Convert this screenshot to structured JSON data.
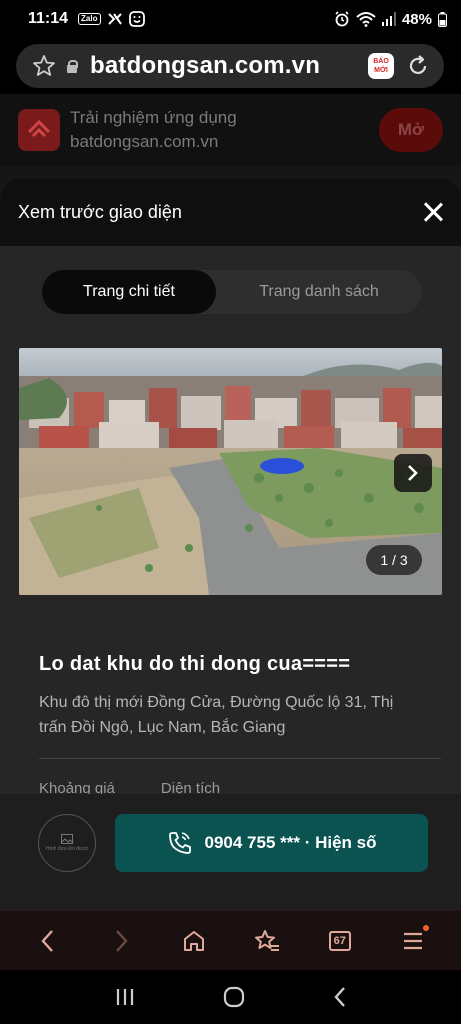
{
  "status_bar": {
    "time": "11:14",
    "notif_icons": [
      "zalo-icon",
      "alarm-off-icon",
      "face-icon"
    ],
    "zalo_label": "Zalo",
    "battery": "48%"
  },
  "browser": {
    "url": "batdongsan.com.vn",
    "baomoi_label": "BÁO MỚI"
  },
  "app_banner": {
    "line1": "Trải nghiệm ứng dụng",
    "line2": "batdongsan.com.vn",
    "open_label": "Mở"
  },
  "sheet": {
    "title": "Xem trước giao diện",
    "tabs": [
      {
        "label": "Trang chi tiết",
        "active": true
      },
      {
        "label": "Trang danh sách",
        "active": false
      }
    ],
    "photo_counter": "1 / 3",
    "listing_title": "Lo dat khu do thi dong cua====",
    "listing_address": "Khu đô thị mới Đồng Cửa, Đường Quốc lộ 31, Thị trấn Đồi Ngô, Lục Nam, Bắc Giang",
    "spec_labels": [
      "Khoảng giá",
      "Diện tích"
    ]
  },
  "contact": {
    "avatar_caption": "Hình đưa lên được",
    "phone_label": "0904 755 *** · Hiện số"
  },
  "colors": {
    "accent_teal": "#0b5350",
    "brand_red": "#7a1a1a",
    "nav_icon": "#e0a898"
  }
}
